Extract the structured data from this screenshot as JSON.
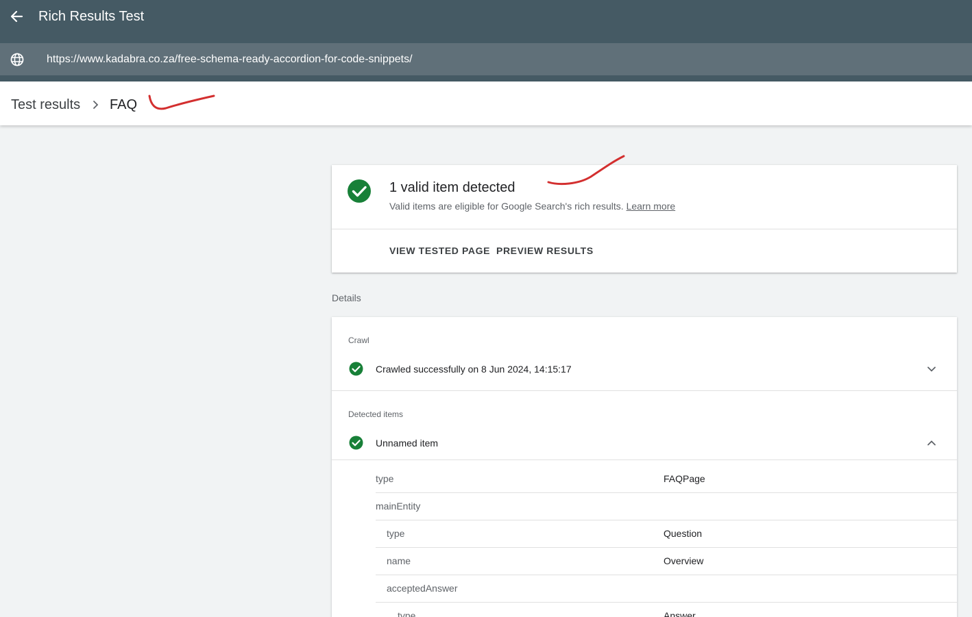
{
  "app": {
    "title": "Rich Results Test",
    "back_icon": "arrow-back-icon"
  },
  "url_bar": {
    "icon": "globe-icon",
    "url": "https://www.kadabra.co.za/free-schema-ready-accordion-for-code-snippets/"
  },
  "breadcrumb": {
    "root": "Test results",
    "separator_icon": "chevron-right-icon",
    "current": "FAQ"
  },
  "summary": {
    "title": "1 valid item detected",
    "subtitle": "Valid items are eligible for Google Search's rich results.",
    "learn_more": "Learn more",
    "actions": [
      "VIEW TESTED PAGE",
      "PREVIEW RESULTS"
    ]
  },
  "details": {
    "label": "Details",
    "crawl": {
      "label": "Crawl",
      "text": "Crawled successfully on 8 Jun 2024, 14:15:17"
    },
    "detected": {
      "label": "Detected items",
      "item": "Unnamed item",
      "properties": [
        {
          "key": "type",
          "value": "FAQPage"
        },
        {
          "key": "mainEntity",
          "value": ""
        },
        {
          "key": "type",
          "value": "Question"
        },
        {
          "key": "name",
          "value": "Overview"
        },
        {
          "key": "acceptedAnswer",
          "value": ""
        },
        {
          "key": "type",
          "value": "Answer"
        }
      ]
    }
  },
  "colors": {
    "appbar": "#455a64",
    "urlbar": "#607079",
    "success_green": "#188038",
    "annotation_red": "#d32f2f"
  }
}
